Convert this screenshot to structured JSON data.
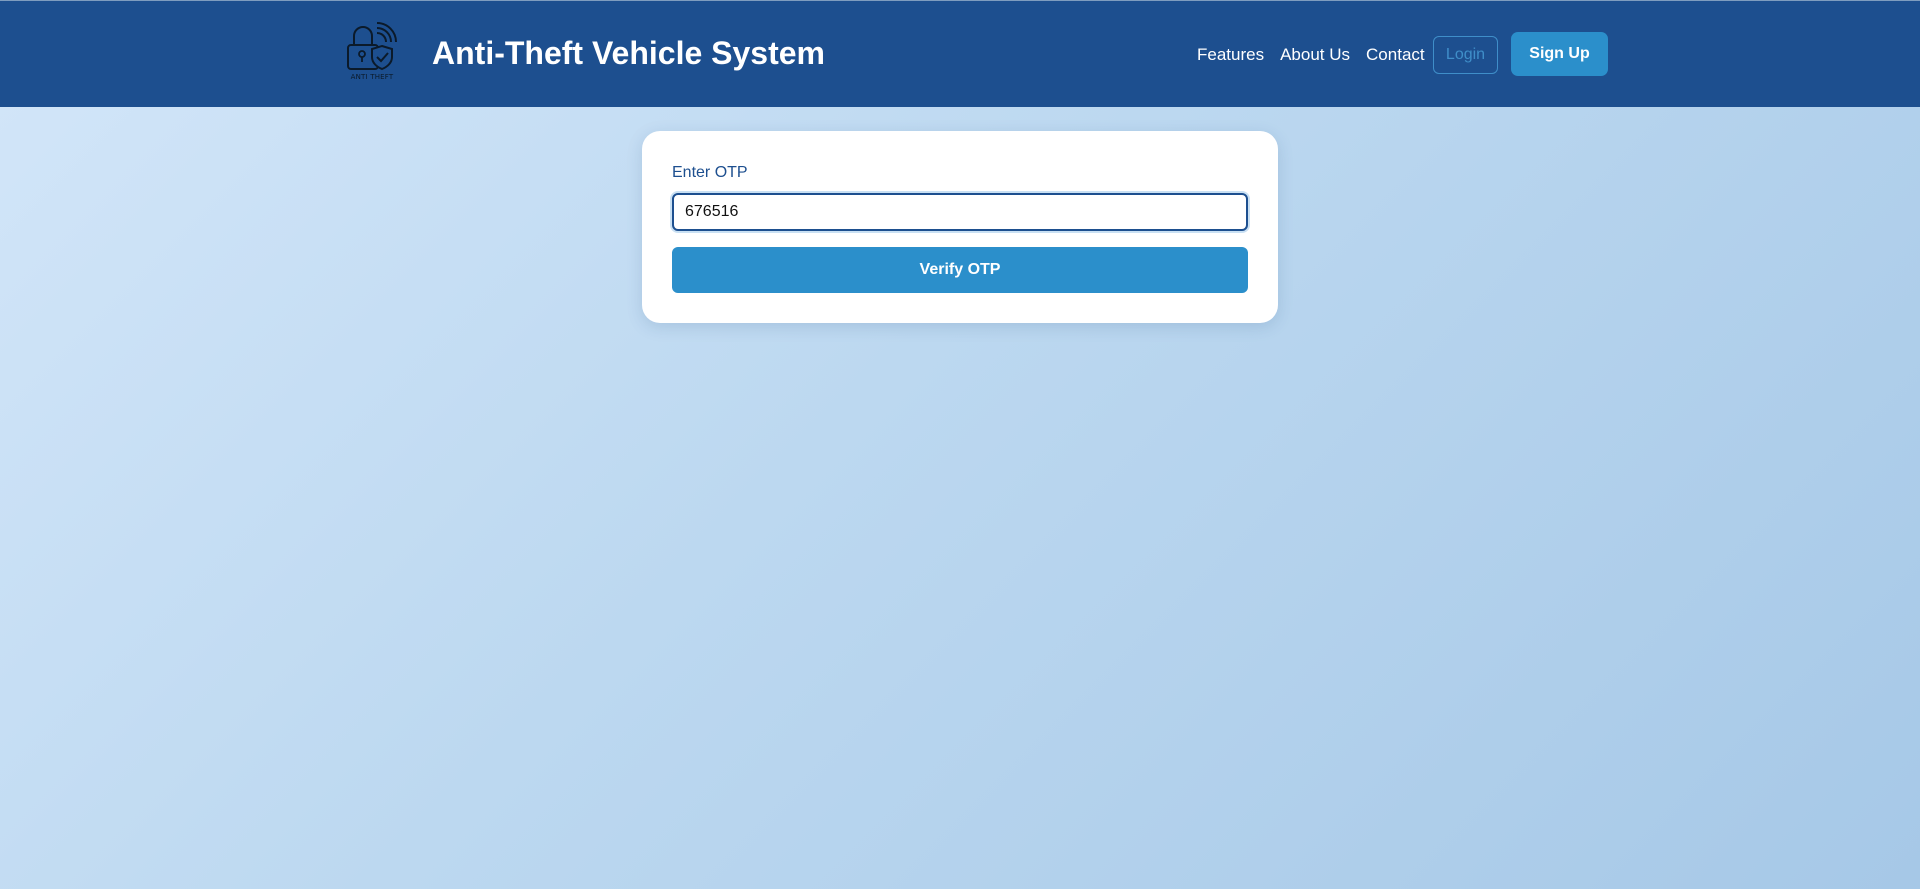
{
  "navbar": {
    "logo_text": "ANTI THEFT",
    "title": "Anti-Theft Vehicle System",
    "links": [
      "Features",
      "About Us",
      "Contact"
    ],
    "login_label": "Login",
    "signup_label": "Sign Up"
  },
  "otp_form": {
    "label": "Enter OTP",
    "value": "676516",
    "verify_label": "Verify OTP"
  },
  "colors": {
    "navbar": "#1d4f8f",
    "accent": "#2b8fcb",
    "login_border": "#3f8ec9",
    "background_light": "#d3e6f9",
    "background_dark": "#a6c8e7"
  },
  "icons": [
    "padlock-shield-wifi-logo-icon"
  ]
}
